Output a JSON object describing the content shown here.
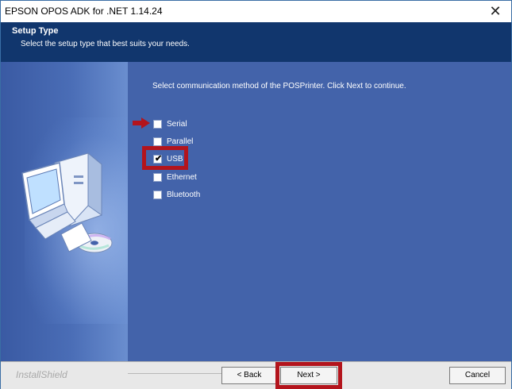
{
  "window": {
    "title": "EPSON OPOS ADK for .NET 1.14.24",
    "close_icon": "close-icon"
  },
  "header": {
    "title": "Setup Type",
    "subtitle": "Select the setup type that best suits your needs."
  },
  "main": {
    "instruction": "Select communication method of the POSPrinter.  Click Next to continue.",
    "options": [
      {
        "label": "Serial",
        "checked": false
      },
      {
        "label": "Parallel",
        "checked": false
      },
      {
        "label": "USB",
        "checked": true
      },
      {
        "label": "Ethernet",
        "checked": false
      },
      {
        "label": "Bluetooth",
        "checked": false
      }
    ],
    "illustration_icon": "computer-cd-icon",
    "pointer_icon": "red-arrow-icon"
  },
  "footer": {
    "brand": "InstallShield",
    "back_label": "< Back",
    "next_label": "Next >",
    "cancel_label": "Cancel"
  },
  "colors": {
    "header_bg": "#11366d",
    "panel_bg": "#4363aa",
    "highlight": "#b3141c"
  }
}
